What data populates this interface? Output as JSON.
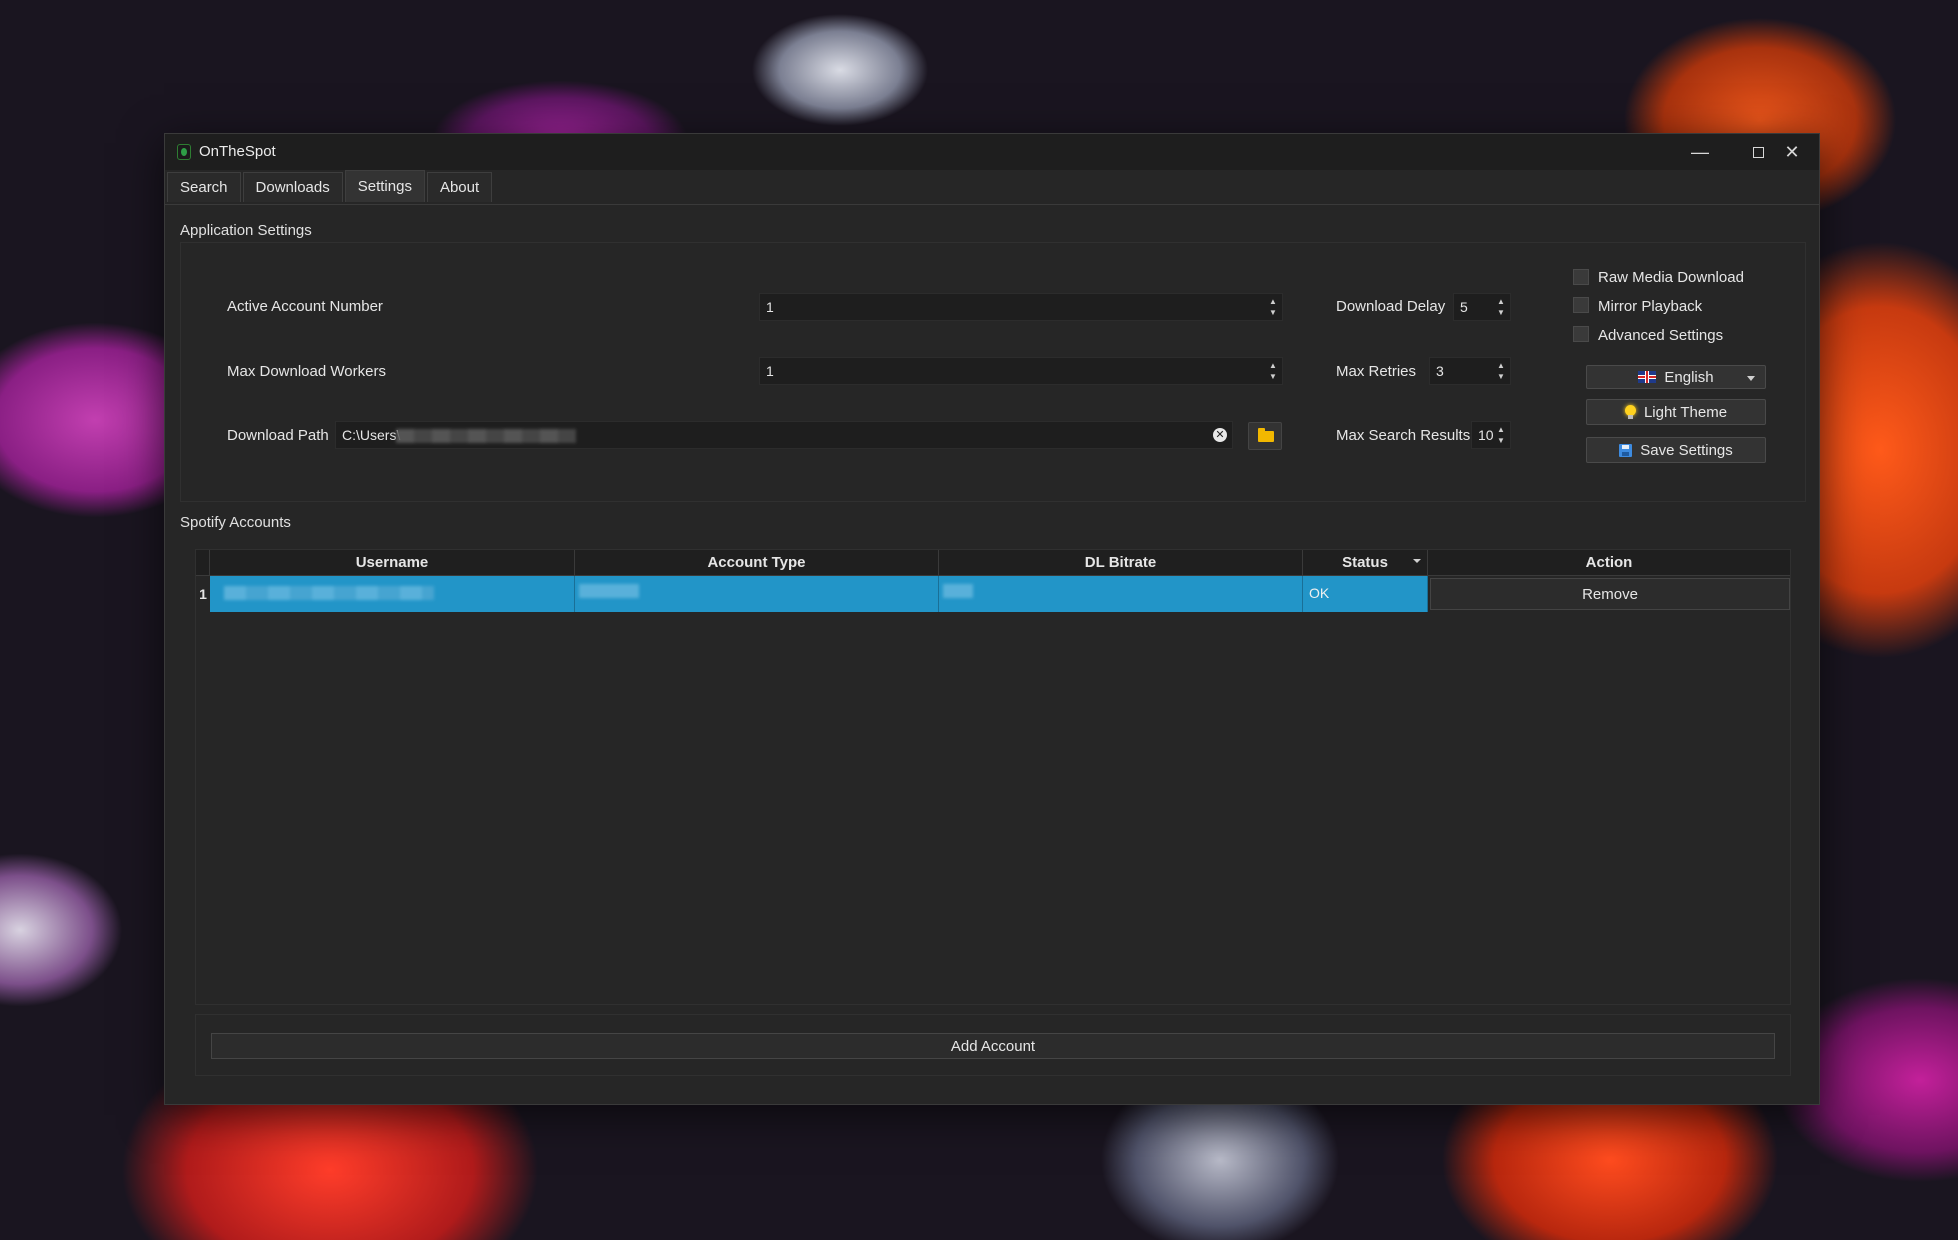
{
  "window": {
    "title": "OnTheSpot",
    "controls": [
      "minimize-icon",
      "maximize-icon",
      "close-icon"
    ]
  },
  "tabs": [
    "Search",
    "Downloads",
    "Settings",
    "About"
  ],
  "active_tab": "Settings",
  "app_settings": {
    "heading": "Application Settings",
    "active_account_number": {
      "label": "Active Account Number",
      "value": "1"
    },
    "max_download_workers": {
      "label": "Max Download Workers",
      "value": "1"
    },
    "download_path": {
      "label": "Download Path",
      "value": "C:\\Users\\"
    },
    "download_delay": {
      "label": "Download Delay",
      "value": "5"
    },
    "max_retries": {
      "label": "Max Retries",
      "value": "3"
    },
    "max_search_results": {
      "label": "Max Search Results",
      "value": "10"
    },
    "checkboxes": {
      "raw_media_download": "Raw Media Download",
      "mirror_playback": "Mirror Playback",
      "advanced_settings": "Advanced Settings"
    },
    "language": "English",
    "theme_button": "Light Theme",
    "save_button": "Save Settings"
  },
  "accounts": {
    "heading": "Spotify Accounts",
    "columns": [
      "Username",
      "Account Type",
      "DL Bitrate",
      "Status",
      "Action"
    ],
    "rows": [
      {
        "index": "1",
        "status": "OK",
        "action": "Remove"
      }
    ],
    "add_button": "Add Account"
  },
  "colors": {
    "selected_row": "#2295c8",
    "window_bg": "#262626",
    "folder_icon": "#f2b800"
  }
}
